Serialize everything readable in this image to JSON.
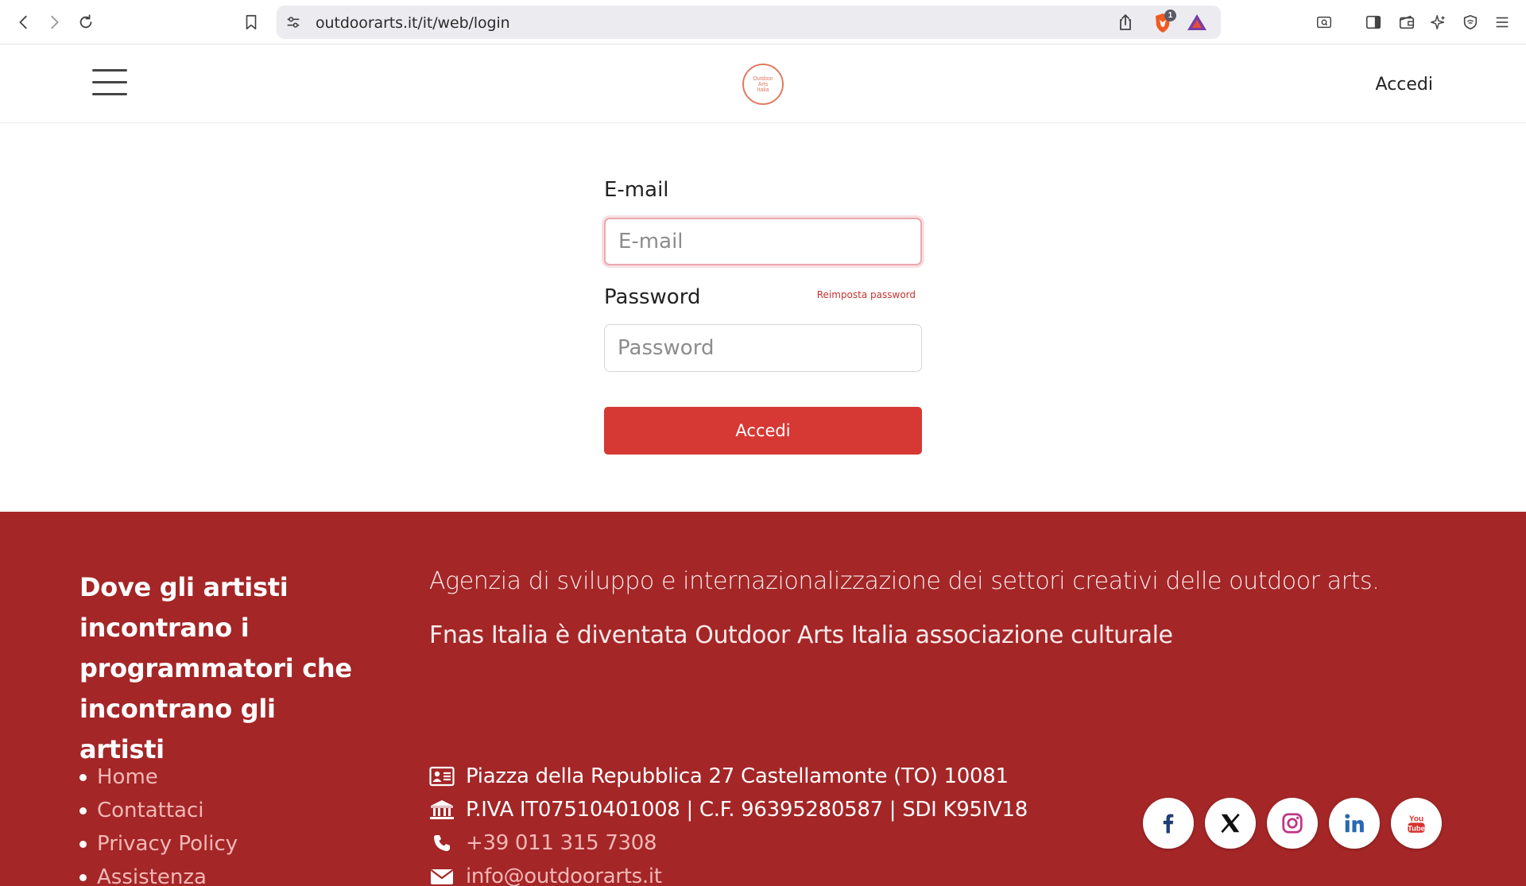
{
  "browser": {
    "url": "outdoorarts.it/it/web/login",
    "notification_badge": "1"
  },
  "header": {
    "logo_lines": [
      "Outdoor",
      "Arts",
      "Italia"
    ],
    "login_link": "Accedi"
  },
  "form": {
    "email_label": "E-mail",
    "email_placeholder": "E-mail",
    "password_label": "Password",
    "password_placeholder": "Password",
    "reset_link": "Reimposta password",
    "submit_label": "Accedi"
  },
  "footer": {
    "background_color": "#a42627",
    "tagline": "Dove gli artisti incontrano i programmatori che incontrano gli artisti",
    "description_1": "Agenzia di sviluppo e internazionalizzazione dei settori creativi delle outdoor arts.",
    "description_2": "Fnas Italia è diventata Outdoor Arts Italia associazione culturale",
    "nav": [
      {
        "label": "Home"
      },
      {
        "label": "Contattaci"
      },
      {
        "label": "Privacy Policy"
      },
      {
        "label": "Assistenza"
      }
    ],
    "contacts": {
      "address": "Piazza della Repubblica 27 Castellamonte (TO) 10081",
      "fiscal": "P.IVA IT07510401008 | C.F. 96395280587 | SDI K95IV18",
      "phone": "+39 011 315 7308",
      "email": "info@outdoorarts.it"
    },
    "socials": [
      {
        "icon": "facebook-icon"
      },
      {
        "icon": "x-icon"
      },
      {
        "icon": "instagram-icon"
      },
      {
        "icon": "linkedin-icon"
      },
      {
        "icon": "youtube-icon"
      }
    ]
  }
}
